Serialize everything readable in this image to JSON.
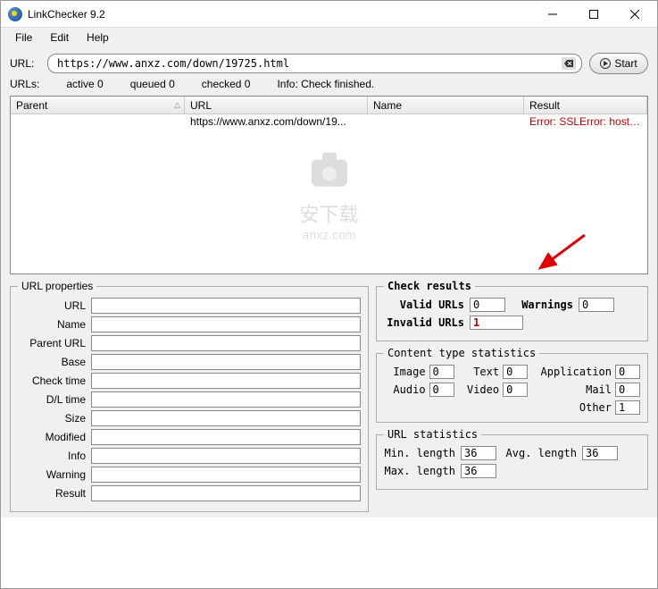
{
  "window": {
    "title": "LinkChecker 9.2"
  },
  "menu": {
    "file": "File",
    "edit": "Edit",
    "help": "Help"
  },
  "urlbar": {
    "label": "URL:",
    "value": "https://www.anxz.com/down/19725.html",
    "start": "Start"
  },
  "status": {
    "urls_label": "URLs:",
    "active": "active 0",
    "queued": "queued 0",
    "checked": "checked 0",
    "info": "Info: Check finished."
  },
  "table": {
    "headers": {
      "parent": "Parent",
      "url": "URL",
      "name": "Name",
      "result": "Result"
    },
    "rows": [
      {
        "parent": "",
        "url": "https://www.anxz.com/down/19...",
        "name": "",
        "result": "Error: SSLError: hostname..."
      }
    ]
  },
  "url_properties": {
    "legend": "URL properties",
    "labels": {
      "url": "URL",
      "name": "Name",
      "parent_url": "Parent URL",
      "base": "Base",
      "check_time": "Check time",
      "dl_time": "D/L time",
      "size": "Size",
      "modified": "Modified",
      "info": "Info",
      "warning": "Warning",
      "result": "Result"
    },
    "values": {
      "url": "",
      "name": "",
      "parent_url": "",
      "base": "",
      "check_time": "",
      "dl_time": "",
      "size": "",
      "modified": "",
      "info": "",
      "warning": "",
      "result": ""
    }
  },
  "check_results": {
    "legend": "Check results",
    "valid_label": "Valid URLs",
    "valid": "0",
    "warnings_label": "Warnings",
    "warnings": "0",
    "invalid_label": "Invalid URLs",
    "invalid": "1"
  },
  "content_stats": {
    "legend": "Content type statistics",
    "image_label": "Image",
    "image": "0",
    "text_label": "Text",
    "text": "0",
    "application_label": "Application",
    "application": "0",
    "audio_label": "Audio",
    "audio": "0",
    "video_label": "Video",
    "video": "0",
    "mail_label": "Mail",
    "mail": "0",
    "other_label": "Other",
    "other": "1"
  },
  "url_stats": {
    "legend": "URL statistics",
    "min_label": "Min. length",
    "min": "36",
    "avg_label": "Avg. length",
    "avg": "36",
    "max_label": "Max. length",
    "max": "36"
  }
}
